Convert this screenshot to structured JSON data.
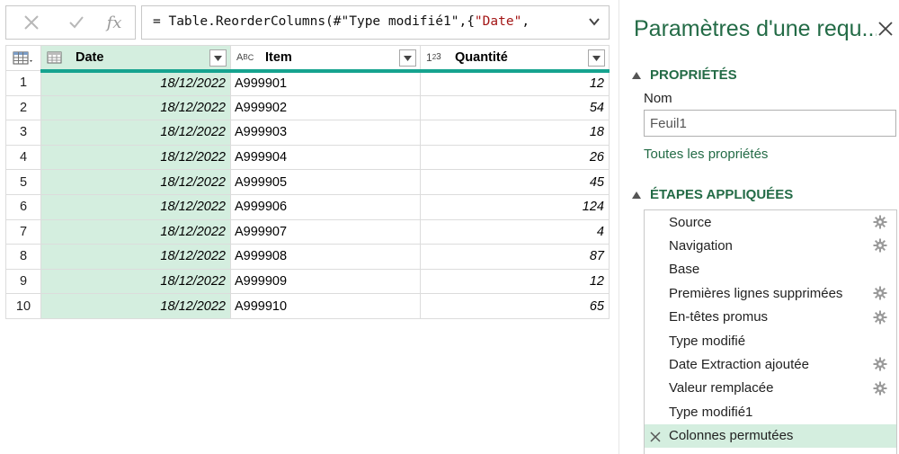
{
  "formula_bar": {
    "cancel_icon": "x-icon",
    "commit_icon": "check-icon",
    "fx_label": "fx",
    "formula_prefix": "= Table.ReorderColumns(#\"Type modifié1\",{",
    "formula_string": "\"Date\"",
    "formula_suffix": ","
  },
  "grid": {
    "columns": [
      {
        "label": "Date",
        "type_icon": "calendar-icon"
      },
      {
        "label": "Item",
        "type_icon": "ABC"
      },
      {
        "label": "Quantité",
        "type_icon": "123"
      }
    ],
    "rows": [
      {
        "n": "1",
        "date": "18/12/2022",
        "item": "A999901",
        "qty": "12"
      },
      {
        "n": "2",
        "date": "18/12/2022",
        "item": "A999902",
        "qty": "54"
      },
      {
        "n": "3",
        "date": "18/12/2022",
        "item": "A999903",
        "qty": "18"
      },
      {
        "n": "4",
        "date": "18/12/2022",
        "item": "A999904",
        "qty": "26"
      },
      {
        "n": "5",
        "date": "18/12/2022",
        "item": "A999905",
        "qty": "45"
      },
      {
        "n": "6",
        "date": "18/12/2022",
        "item": "A999906",
        "qty": "124"
      },
      {
        "n": "7",
        "date": "18/12/2022",
        "item": "A999907",
        "qty": "4"
      },
      {
        "n": "8",
        "date": "18/12/2022",
        "item": "A999908",
        "qty": "87"
      },
      {
        "n": "9",
        "date": "18/12/2022",
        "item": "A999909",
        "qty": "12"
      },
      {
        "n": "10",
        "date": "18/12/2022",
        "item": "A999910",
        "qty": "65"
      }
    ]
  },
  "pane": {
    "title": "Paramètres d'une requ...",
    "properties_header": "PROPRIÉTÉS",
    "name_label": "Nom",
    "name_value": "Feuil1",
    "all_properties_link": "Toutes les propriétés",
    "steps_header": "ÉTAPES APPLIQUÉES",
    "steps": [
      {
        "label": "Source",
        "gear": true
      },
      {
        "label": "Navigation",
        "gear": true
      },
      {
        "label": "Base",
        "gear": false
      },
      {
        "label": "Premières lignes supprimées",
        "gear": true
      },
      {
        "label": "En-têtes promus",
        "gear": true
      },
      {
        "label": "Type modifié",
        "gear": false
      },
      {
        "label": "Date Extraction ajoutée",
        "gear": true
      },
      {
        "label": "Valeur remplacée",
        "gear": true
      },
      {
        "label": "Type modifié1",
        "gear": false
      },
      {
        "label": "Colonnes permutées",
        "gear": false,
        "active": true
      }
    ]
  },
  "colors": {
    "accent_green": "#236b46",
    "selected_column": "#d4eedf",
    "teal_bar": "#16a38f"
  }
}
